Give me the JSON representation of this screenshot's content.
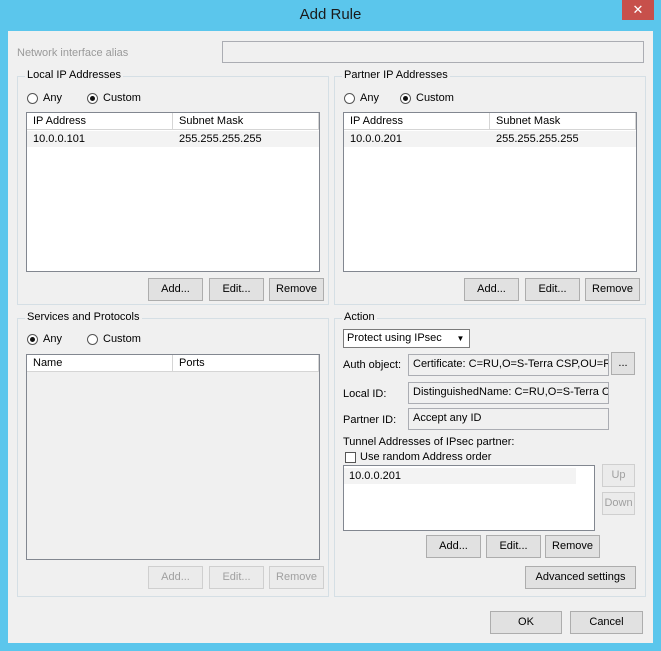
{
  "window": {
    "title": "Add Rule",
    "close_glyph": "✕"
  },
  "alias": {
    "label": "Network interface alias",
    "value": ""
  },
  "local": {
    "group_title": "Local IP Addresses",
    "any_label": "Any",
    "custom_label": "Custom",
    "selected": "Custom",
    "columns": [
      "IP Address",
      "Subnet Mask"
    ],
    "rows": [
      {
        "ip": "10.0.0.101",
        "mask": "255.255.255.255"
      }
    ],
    "add": "Add...",
    "edit": "Edit...",
    "remove": "Remove"
  },
  "partner": {
    "group_title": "Partner IP Addresses",
    "any_label": "Any",
    "custom_label": "Custom",
    "selected": "Custom",
    "columns": [
      "IP Address",
      "Subnet Mask"
    ],
    "rows": [
      {
        "ip": "10.0.0.201",
        "mask": "255.255.255.255"
      }
    ],
    "add": "Add...",
    "edit": "Edit...",
    "remove": "Remove"
  },
  "services": {
    "group_title": "Services and Protocols",
    "any_label": "Any",
    "custom_label": "Custom",
    "selected": "Any",
    "columns": [
      "Name",
      "Ports"
    ],
    "add": "Add...",
    "edit": "Edit...",
    "remove": "Remove"
  },
  "action": {
    "group_title": "Action",
    "mode": "Protect using IPsec",
    "auth_label": "Auth object:",
    "auth_value": "Certificate: C=RU,O=S-Terra CSP,OU=R",
    "browse": "...",
    "local_id_label": "Local ID:",
    "local_id_value": "DistinguishedName: C=RU,O=S-Terra CSP",
    "partner_id_label": "Partner ID:",
    "partner_id_value": "Accept any ID",
    "tunnel_label": "Tunnel Addresses of IPsec partner:",
    "random_order_label": "Use random Address order",
    "random_order_checked": false,
    "tunnel_addresses": [
      "10.0.0.201"
    ],
    "up": "Up",
    "down": "Down",
    "add": "Add...",
    "edit": "Edit...",
    "remove": "Remove",
    "advanced": "Advanced settings"
  },
  "footer": {
    "ok": "OK",
    "cancel": "Cancel"
  }
}
